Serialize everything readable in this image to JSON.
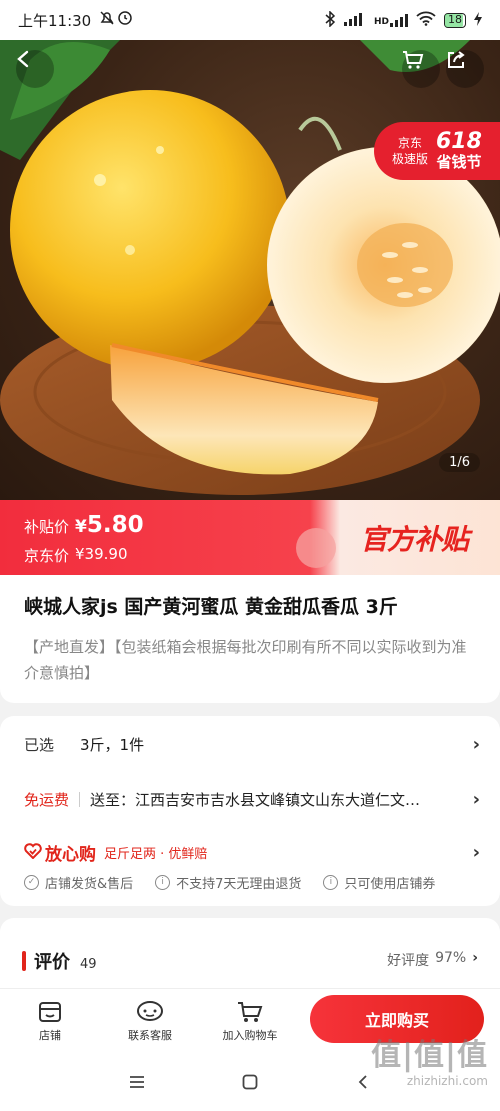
{
  "status": {
    "time": "上午11:30",
    "signal_label": "HD",
    "battery": "18"
  },
  "hero": {
    "image_counter": "1/6",
    "promo": {
      "line1": "京东",
      "line2": "极速版",
      "number": "618",
      "slogan": "省钱节"
    }
  },
  "price": {
    "subsidy_label": "补贴价",
    "currency": "¥",
    "subsidy_value": "5.80",
    "jd_label": "京东价",
    "jd_value": "¥39.90",
    "official_tag": "官方补贴"
  },
  "product": {
    "title": "峡城人家js 国产黄河蜜瓜 黄金甜瓜香瓜 3斤",
    "description": "【产地直发】【包装纸箱会根据每批次印刷有所不同以实际收到为准介意慎拍】"
  },
  "options": {
    "selected_label": "已选",
    "selected_value": "3斤，1件",
    "shipping_free": "免运费",
    "ship_to": "送至：江西吉安市吉水县文峰镇文山东大道仁文…",
    "assure_name": "放心购",
    "assure_desc": "足斤足两 · 优鲜赔",
    "services": [
      "店铺发货&售后",
      "不支持7天无理由退货",
      "只可使用店铺券"
    ]
  },
  "reviews": {
    "title": "评价",
    "count": "49",
    "rate_label": "好评度",
    "rate_value": "97%"
  },
  "bottom": {
    "shop": "店铺",
    "service": "联系客服",
    "cart": "加入购物车",
    "buy": "立即购买"
  },
  "watermark": {
    "big": "值|值|值",
    "small": "zhizhizhi.com"
  },
  "colors": {
    "accent": "#e1251b",
    "price_bar": "#f22d3d"
  }
}
